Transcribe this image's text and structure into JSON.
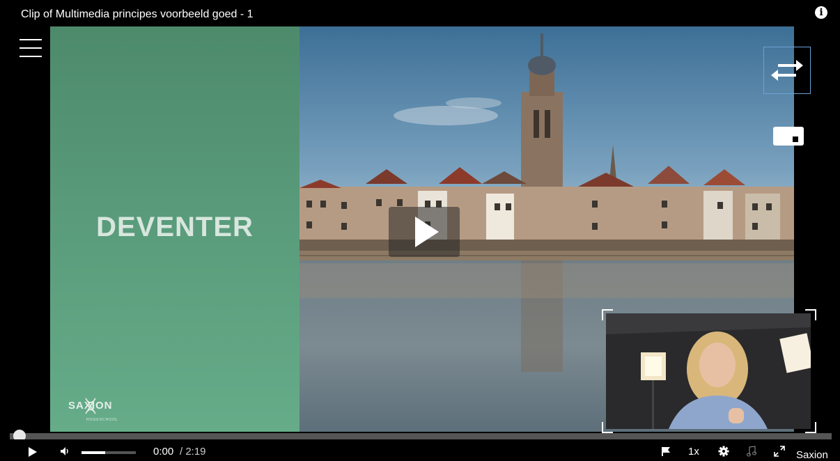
{
  "player": {
    "title": "Clip of Multimedia principes voorbeeld goed - 1",
    "info_icon": "info-circle-icon",
    "accent_color": "#6aa3d6"
  },
  "slide": {
    "heading": "DEVENTER",
    "background_color": "#5b9e7d",
    "logo_text": "SAXION",
    "logo_subtext": "HOGESCHOOL"
  },
  "overlay": {
    "menu_icon": "hamburger-menu-icon",
    "swap_icon": "swap-arrows-icon",
    "pip_toggle_icon": "picture-in-picture-icon",
    "big_play_icon": "play-icon"
  },
  "controls": {
    "play_icon": "play-icon",
    "volume_icon": "volume-icon",
    "volume_level": 0.44,
    "current_time": "0:00",
    "duration": "/ 2:19",
    "progress": 0,
    "flag_icon": "flag-icon",
    "speed_label": "1x",
    "settings_icon": "gear-icon",
    "audio_icon": "music-note-icon",
    "fullscreen_icon": "expand-icon",
    "partner_logo_alt": "Saxion"
  }
}
